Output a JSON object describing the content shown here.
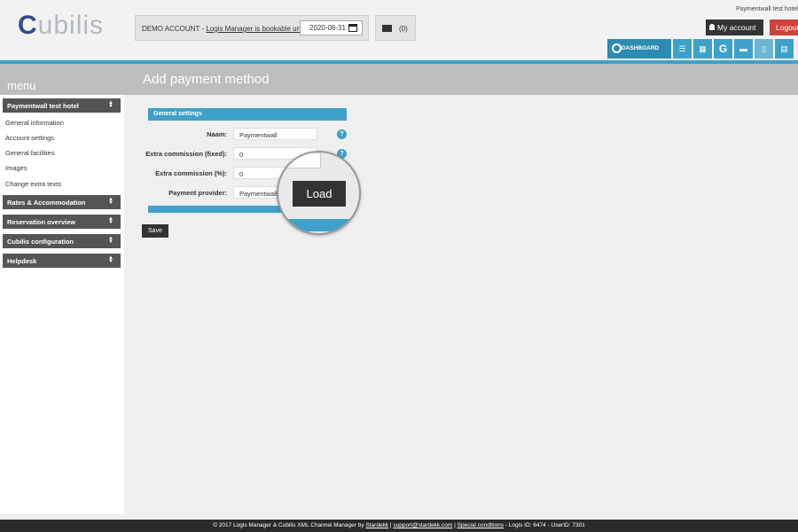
{
  "header": {
    "logo_first": "C",
    "logo_rest": "ubilis",
    "demo_prefix": "DEMO ACCOUNT - ",
    "demo_link": "Logis Manager is bookable until",
    "bookable_until": "2020-08-31",
    "message_count": "(0)",
    "hotel_name": "Paymentwall test hotel",
    "account_label": "My account",
    "logout_label": "Logout"
  },
  "nav": {
    "dashboard_label": "DASHBOARD",
    "icons": [
      "list-icon",
      "grid-icon",
      "google-icon",
      "bed-icon",
      "door-icon",
      "calculator-icon"
    ]
  },
  "sidebar": {
    "menu_title": "menu",
    "sections": [
      {
        "label": "Paymentwall test hotel"
      },
      {
        "label": "Rates & Accommodation"
      },
      {
        "label": "Reservation overview"
      },
      {
        "label": "Cubilis configuration"
      },
      {
        "label": "Helpdesk"
      }
    ],
    "items": [
      {
        "label": "General information"
      },
      {
        "label": "Account settings"
      },
      {
        "label": "General facilities"
      },
      {
        "label": "Images"
      },
      {
        "label": "Change extra texts"
      }
    ]
  },
  "main": {
    "title": "Add payment method",
    "section_title": "General settings",
    "fields": [
      {
        "label": "Naam:",
        "value": "Paymentwall"
      },
      {
        "label": "Extra commission (fixed):",
        "value": "0"
      },
      {
        "label": "Extra commission (%):",
        "value": "0"
      },
      {
        "label": "Payment provider:",
        "value": "Paymentwall"
      }
    ],
    "help_glyph": "?",
    "save_label": "Save",
    "load_label": "Load"
  },
  "footer": {
    "part1": "© 2017 Logis Manager & Cubilis XML Channel Manager by ",
    "stardekk": "Stardekk",
    "sep1": " | ",
    "support": "support@stardekk.com",
    "sep2": " | ",
    "special": "Special conditions",
    "part2": " - Logis ID: 6474 - UserID: 7301"
  },
  "colors": {
    "accent": "#3ea1c9",
    "dark": "#333333",
    "logout": "#d0433d",
    "menu_gray": "#bdbdbd"
  }
}
